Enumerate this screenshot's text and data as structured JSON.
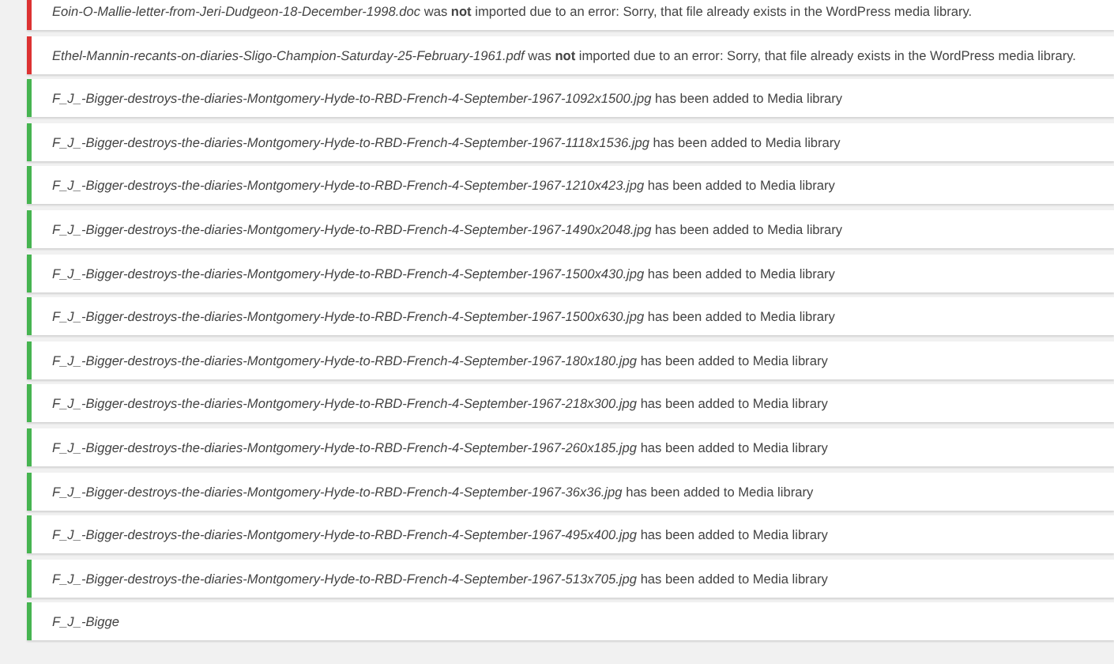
{
  "notices": [
    {
      "kind": "error",
      "filename": "Eoin-O-Mallie-letter-from-Jeri-Dudgeon-18-December-1998.doc",
      "message": "was **not** imported due to an error: Sorry, that file already exists in the WordPress media library."
    },
    {
      "kind": "error",
      "filename": "Ethel-Mannin-recants-on-diaries-Sligo-Champion-Saturday-25-February-1961.pdf",
      "message": "was **not** imported due to an error: Sorry, that file already exists in the WordPress media library."
    },
    {
      "kind": "success",
      "filename": "F_J_-Bigger-destroys-the-diaries-Montgomery-Hyde-to-RBD-French-4-September-1967-1092x1500.jpg",
      "message": "has been added to Media library"
    },
    {
      "kind": "success",
      "filename": "F_J_-Bigger-destroys-the-diaries-Montgomery-Hyde-to-RBD-French-4-September-1967-1118x1536.jpg",
      "message": "has been added to Media library"
    },
    {
      "kind": "success",
      "filename": "F_J_-Bigger-destroys-the-diaries-Montgomery-Hyde-to-RBD-French-4-September-1967-1210x423.jpg",
      "message": "has been added to Media library"
    },
    {
      "kind": "success",
      "filename": "F_J_-Bigger-destroys-the-diaries-Montgomery-Hyde-to-RBD-French-4-September-1967-1490x2048.jpg",
      "message": "has been added to Media library"
    },
    {
      "kind": "success",
      "filename": "F_J_-Bigger-destroys-the-diaries-Montgomery-Hyde-to-RBD-French-4-September-1967-1500x430.jpg",
      "message": "has been added to Media library"
    },
    {
      "kind": "success",
      "filename": "F_J_-Bigger-destroys-the-diaries-Montgomery-Hyde-to-RBD-French-4-September-1967-1500x630.jpg",
      "message": "has been added to Media library"
    },
    {
      "kind": "success",
      "filename": "F_J_-Bigger-destroys-the-diaries-Montgomery-Hyde-to-RBD-French-4-September-1967-180x180.jpg",
      "message": "has been added to Media library"
    },
    {
      "kind": "success",
      "filename": "F_J_-Bigger-destroys-the-diaries-Montgomery-Hyde-to-RBD-French-4-September-1967-218x300.jpg",
      "message": "has been added to Media library"
    },
    {
      "kind": "success",
      "filename": "F_J_-Bigger-destroys-the-diaries-Montgomery-Hyde-to-RBD-French-4-September-1967-260x185.jpg",
      "message": "has been added to Media library"
    },
    {
      "kind": "success",
      "filename": "F_J_-Bigger-destroys-the-diaries-Montgomery-Hyde-to-RBD-French-4-September-1967-36x36.jpg",
      "message": "has been added to Media library"
    },
    {
      "kind": "success",
      "filename": "F_J_-Bigger-destroys-the-diaries-Montgomery-Hyde-to-RBD-French-4-September-1967-495x400.jpg",
      "message": "has been added to Media library"
    },
    {
      "kind": "success",
      "filename": "F_J_-Bigger-destroys-the-diaries-Montgomery-Hyde-to-RBD-French-4-September-1967-513x705.jpg",
      "message": "has been added to Media library"
    },
    {
      "kind": "success",
      "filename": "F_J_-Bigge"
    }
  ]
}
